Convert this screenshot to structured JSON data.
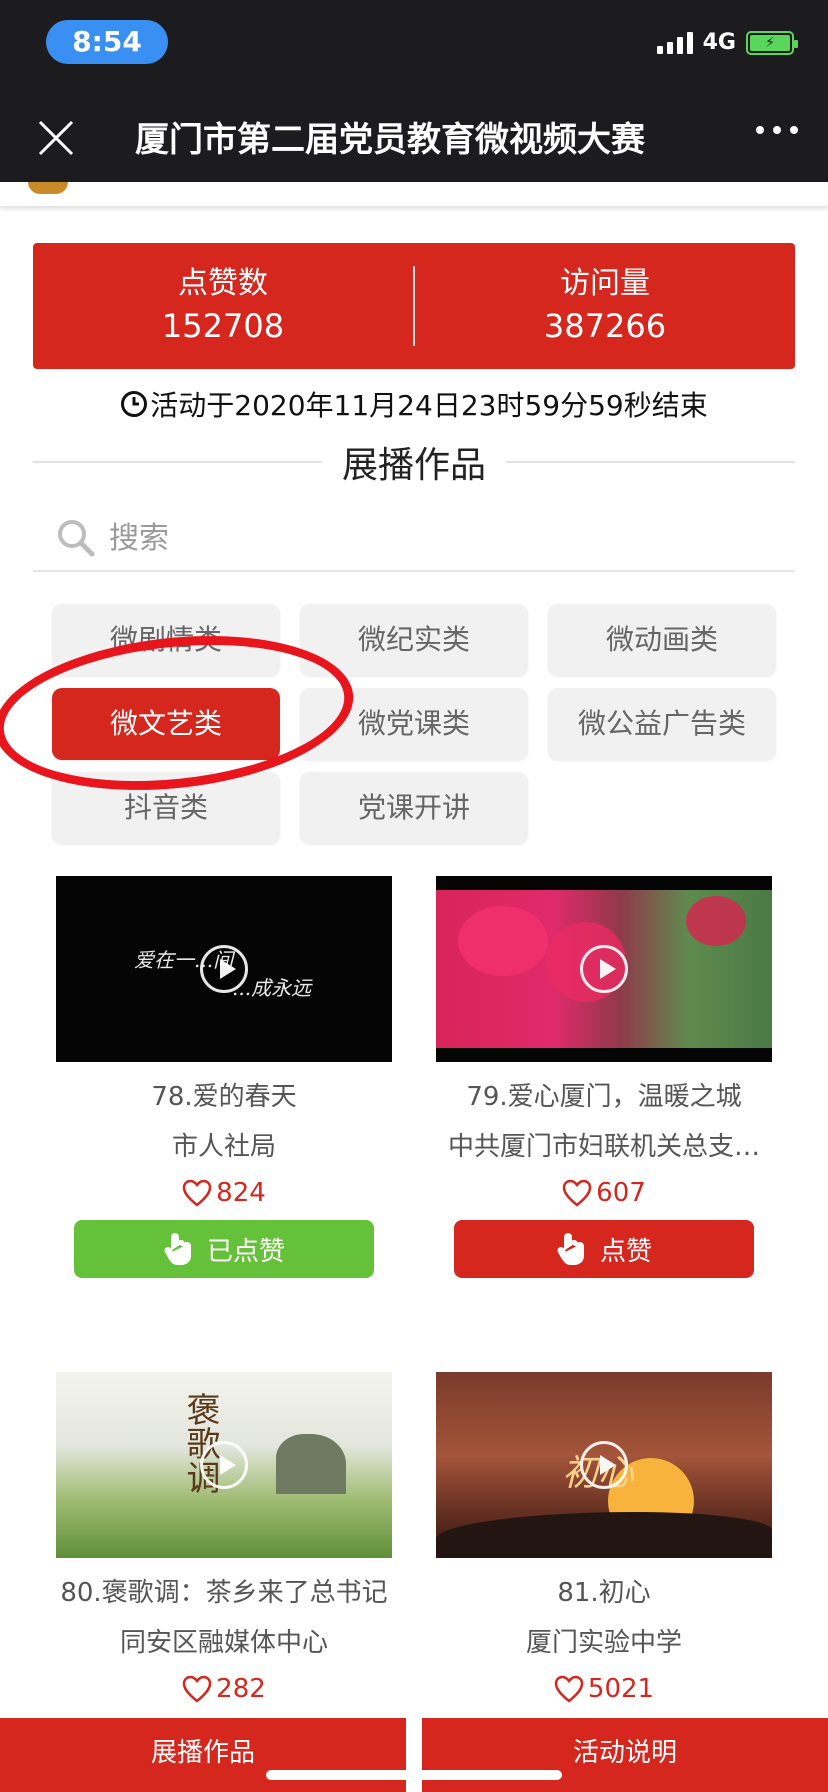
{
  "status_bar": {
    "time": "8:54",
    "network": "4G"
  },
  "header": {
    "title": "厦门市第二届党员教育微视频大赛"
  },
  "stats": {
    "likes_label": "点赞数",
    "likes_value": "152708",
    "visits_label": "访问量",
    "visits_value": "387266"
  },
  "deadline": "活动于2020年11月24日23时59分59秒结束",
  "section_title": "展播作品",
  "search": {
    "placeholder": "搜索"
  },
  "categories": [
    "微剧情类",
    "微纪实类",
    "微动画类",
    "微文艺类",
    "微党课类",
    "微公益广告类",
    "抖音类",
    "党课开讲"
  ],
  "active_category": "微文艺类",
  "videos": [
    {
      "title": "78.爱的春天",
      "org": "市人社局",
      "likes": "824",
      "button": "已点赞",
      "thumb_text_a": "爱在一...间",
      "thumb_text_b": "...成永远"
    },
    {
      "title": "79.爱心厦门，温暖之城",
      "org": "中共厦门市妇联机关总支…",
      "likes": "607",
      "button": "点赞"
    },
    {
      "title": "80.褒歌调：茶乡来了总书记",
      "org": "同安区融媒体中心",
      "likes": "282",
      "thumb_text_a": "褒歌调"
    },
    {
      "title": "81.初心",
      "org": "厦门实验中学",
      "likes": "5021",
      "thumb_text_a": "初心"
    }
  ],
  "bottom_nav": {
    "left": "展播作品",
    "right": "活动说明"
  },
  "colors": {
    "brand_red": "#d6271f",
    "liked_green": "#66c13a",
    "highlight": "#e8161c"
  }
}
